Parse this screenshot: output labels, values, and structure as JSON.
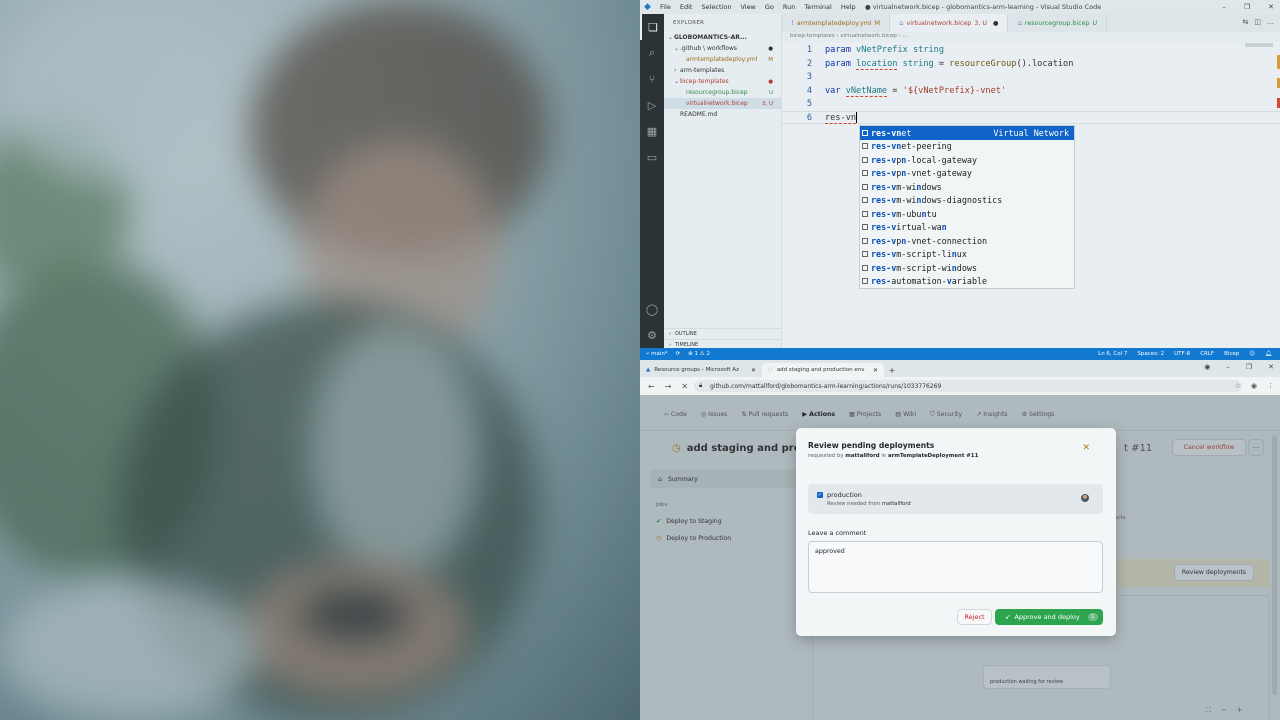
{
  "vscode": {
    "menu": [
      "File",
      "Edit",
      "Selection",
      "View",
      "Go",
      "Run",
      "Terminal",
      "Help"
    ],
    "window_title": "● virtualnetwork.bicep - globomantics-arm-learning - Visual Studio Code",
    "explorer_header": "EXPLORER",
    "tree": [
      {
        "label": "GLOBOMANTICS-AR...",
        "mark": "",
        "indent": 0,
        "chevron": "⌄",
        "bold": true,
        "color": "#333333"
      },
      {
        "label": ".github \\ workflows",
        "mark": "●",
        "indent": 1,
        "chevron": "⌄",
        "bold": false,
        "color": "#333333"
      },
      {
        "label": "armtemplatedeploy.yml",
        "mark": "M",
        "indent": 2,
        "chevron": "",
        "bold": false,
        "color": "#a0691f"
      },
      {
        "label": "arm-templates",
        "mark": "",
        "indent": 1,
        "chevron": "›",
        "bold": false,
        "color": "#333333"
      },
      {
        "label": "bicep-templates",
        "mark": "●",
        "indent": 1,
        "chevron": "⌄",
        "bold": false,
        "color": "#b0413a"
      },
      {
        "label": "resourcegroup.bicep",
        "mark": "U",
        "indent": 2,
        "chevron": "",
        "bold": false,
        "color": "#2d8a4e"
      },
      {
        "label": "virtualnetwork.bicep",
        "mark": "3, U",
        "indent": 2,
        "chevron": "",
        "bold": false,
        "color": "#b0413a"
      },
      {
        "label": "README.md",
        "mark": "",
        "indent": 1,
        "chevron": "",
        "bold": false,
        "color": "#333333"
      }
    ],
    "outline_label": "OUTLINE",
    "timeline_label": "TIMELINE",
    "tabs": [
      {
        "label": "armtemplatedeploy.yml",
        "suffix": "M",
        "active": false,
        "color": "#a0691f"
      },
      {
        "label": "virtualnetwork.bicep",
        "suffix": "3, U",
        "active": true,
        "color": "#b0413a"
      },
      {
        "label": "resourcegroup.bicep",
        "suffix": "U",
        "active": false,
        "color": "#2d8a4e"
      }
    ],
    "breadcrumb": "bicep-templates › virtualnetwork.bicep › ...",
    "code_lines": [
      {
        "n": "1",
        "tokens": [
          [
            "kw",
            "param "
          ],
          [
            "id",
            "vNetPrefix "
          ],
          [
            "ty",
            "string"
          ]
        ]
      },
      {
        "n": "2",
        "tokens": [
          [
            "kw",
            "param "
          ],
          [
            "id cur",
            "location"
          ],
          [
            "tx",
            " "
          ],
          [
            "ty",
            "string"
          ],
          [
            "tx",
            " = "
          ],
          [
            "fn",
            "resourceGroup"
          ],
          [
            "tx",
            "().location"
          ]
        ]
      },
      {
        "n": "3",
        "tokens": []
      },
      {
        "n": "4",
        "tokens": [
          [
            "kw",
            "var "
          ],
          [
            "id cur",
            "vNetName"
          ],
          [
            "tx",
            " = "
          ],
          [
            "st",
            "'${vNetPrefix}-vnet'"
          ]
        ]
      },
      {
        "n": "5",
        "tokens": []
      },
      {
        "n": "6",
        "tokens": [
          [
            "tx cur",
            "res-vn"
          ]
        ]
      }
    ],
    "suggestions": [
      {
        "label": "res-vnet",
        "detail": "Virtual Network",
        "selected": true
      },
      {
        "label": "res-vnet-peering",
        "detail": "",
        "selected": false
      },
      {
        "label": "res-vpn-local-gateway",
        "detail": "",
        "selected": false
      },
      {
        "label": "res-vpn-vnet-gateway",
        "detail": "",
        "selected": false
      },
      {
        "label": "res-vm-windows",
        "detail": "",
        "selected": false
      },
      {
        "label": "res-vm-windows-diagnostics",
        "detail": "",
        "selected": false
      },
      {
        "label": "res-vm-ubuntu",
        "detail": "",
        "selected": false
      },
      {
        "label": "res-virtual-wan",
        "detail": "",
        "selected": false
      },
      {
        "label": "res-vpn-vnet-connection",
        "detail": "",
        "selected": false
      },
      {
        "label": "res-vm-script-linux",
        "detail": "",
        "selected": false
      },
      {
        "label": "res-vm-script-windows",
        "detail": "",
        "selected": false
      },
      {
        "label": "res-automation-variable",
        "detail": "",
        "selected": false
      }
    ],
    "status": {
      "branch": "main*",
      "problems": "⊗ 1 ⚠ 2",
      "position": "Ln 6, Col 7",
      "spaces": "Spaces: 2",
      "encoding": "UTF-8",
      "eol": "CRLF",
      "language": "Bicep"
    },
    "accent": "#1279d1"
  },
  "browser": {
    "tabs": [
      {
        "label": "Resource groups - Microsoft Az",
        "active": false
      },
      {
        "label": "add staging and production env",
        "active": true
      }
    ],
    "url": "github.com/mattallford/globomantics-arm-learning/actions/runs/1033776269",
    "repo_nav": [
      "Code",
      "Issues",
      "Pull requests",
      "Actions",
      "Projects",
      "Wiki",
      "Security",
      "Insights",
      "Settings"
    ],
    "repo_nav_active": "Actions",
    "run_title": "add staging and production",
    "run_number": "t #11",
    "cancel_label": "Cancel workflow",
    "summary_label": "Summary",
    "jobs_label": "Jobs",
    "jobs": [
      {
        "label": "Deploy to Staging",
        "status": "ok"
      },
      {
        "label": "Deploy to Production",
        "status": "wait"
      }
    ],
    "artifacts_label": "facts",
    "review_button": "Review deployments",
    "prod_card_text": "production waiting for review",
    "modal": {
      "title": "Review pending deployments",
      "requested_prefix": "requested by",
      "requested_user": "mattallford",
      "requested_in": "in",
      "requested_run": "armTemplateDeployment #11",
      "env_name": "production",
      "review_needed_prefix": "Review needed from",
      "review_needed_user": "mattallford",
      "comment_label": "Leave a comment",
      "comment_value": "approved",
      "reject_label": "Reject",
      "approve_label": "Approve and deploy",
      "approve_count": "1",
      "approve_color": "#2da44e",
      "reject_color": "#cf222e"
    }
  }
}
